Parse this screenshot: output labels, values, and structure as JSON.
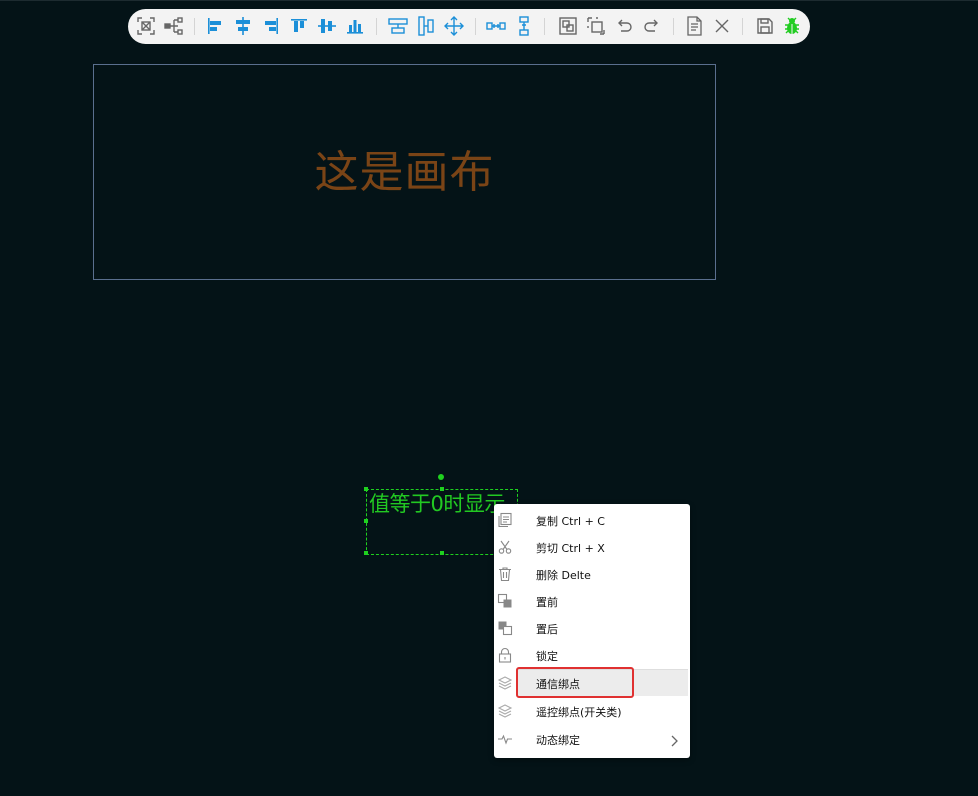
{
  "colors": {
    "background": "#041317",
    "toolbar_icon_blue": "#1b8fd8",
    "toolbar_icon_gray": "#666666",
    "bug_icon_green": "#22cc22",
    "canvas_text": "#7a4416",
    "selection_green": "#1fd11f",
    "highlight_red": "#e03131"
  },
  "toolbar": {
    "items": [
      {
        "icon": "fit-view-icon"
      },
      {
        "icon": "tree-structure-icon"
      },
      {
        "icon": "align-left-icon"
      },
      {
        "icon": "align-center-horizontal-icon"
      },
      {
        "icon": "align-right-icon"
      },
      {
        "icon": "align-top-icon"
      },
      {
        "icon": "align-middle-vertical-icon"
      },
      {
        "icon": "align-bottom-icon"
      },
      {
        "icon": "distribute-horizontal-icon"
      },
      {
        "icon": "distribute-vertical-icon"
      },
      {
        "icon": "move-icon"
      },
      {
        "icon": "equal-spacing-horizontal-icon"
      },
      {
        "icon": "equal-spacing-vertical-icon"
      },
      {
        "icon": "group-icon"
      },
      {
        "icon": "ungroup-icon"
      },
      {
        "icon": "undo-icon"
      },
      {
        "icon": "redo-icon"
      },
      {
        "icon": "export-document-icon"
      },
      {
        "icon": "clear-icon"
      },
      {
        "icon": "save-icon"
      },
      {
        "icon": "debug-bug-icon"
      }
    ]
  },
  "canvas": {
    "label": "这是画布"
  },
  "selected_element": {
    "text": "值等于0时显示"
  },
  "context_menu": {
    "items": [
      {
        "label": "复制 Ctrl + C",
        "icon": "copy-icon"
      },
      {
        "label": "剪切 Ctrl + X",
        "icon": "cut-icon"
      },
      {
        "label": "删除 Delte",
        "icon": "delete-icon"
      },
      {
        "label": "置前",
        "icon": "bring-front-icon"
      },
      {
        "label": "置后",
        "icon": "send-back-icon"
      },
      {
        "label": "锁定",
        "icon": "lock-icon"
      },
      {
        "label": "通信绑点",
        "icon": "layers-icon"
      },
      {
        "label": "遥控绑点(开关类)",
        "icon": "layers-icon"
      },
      {
        "label": "动态绑定",
        "icon": "pulse-icon"
      }
    ]
  }
}
